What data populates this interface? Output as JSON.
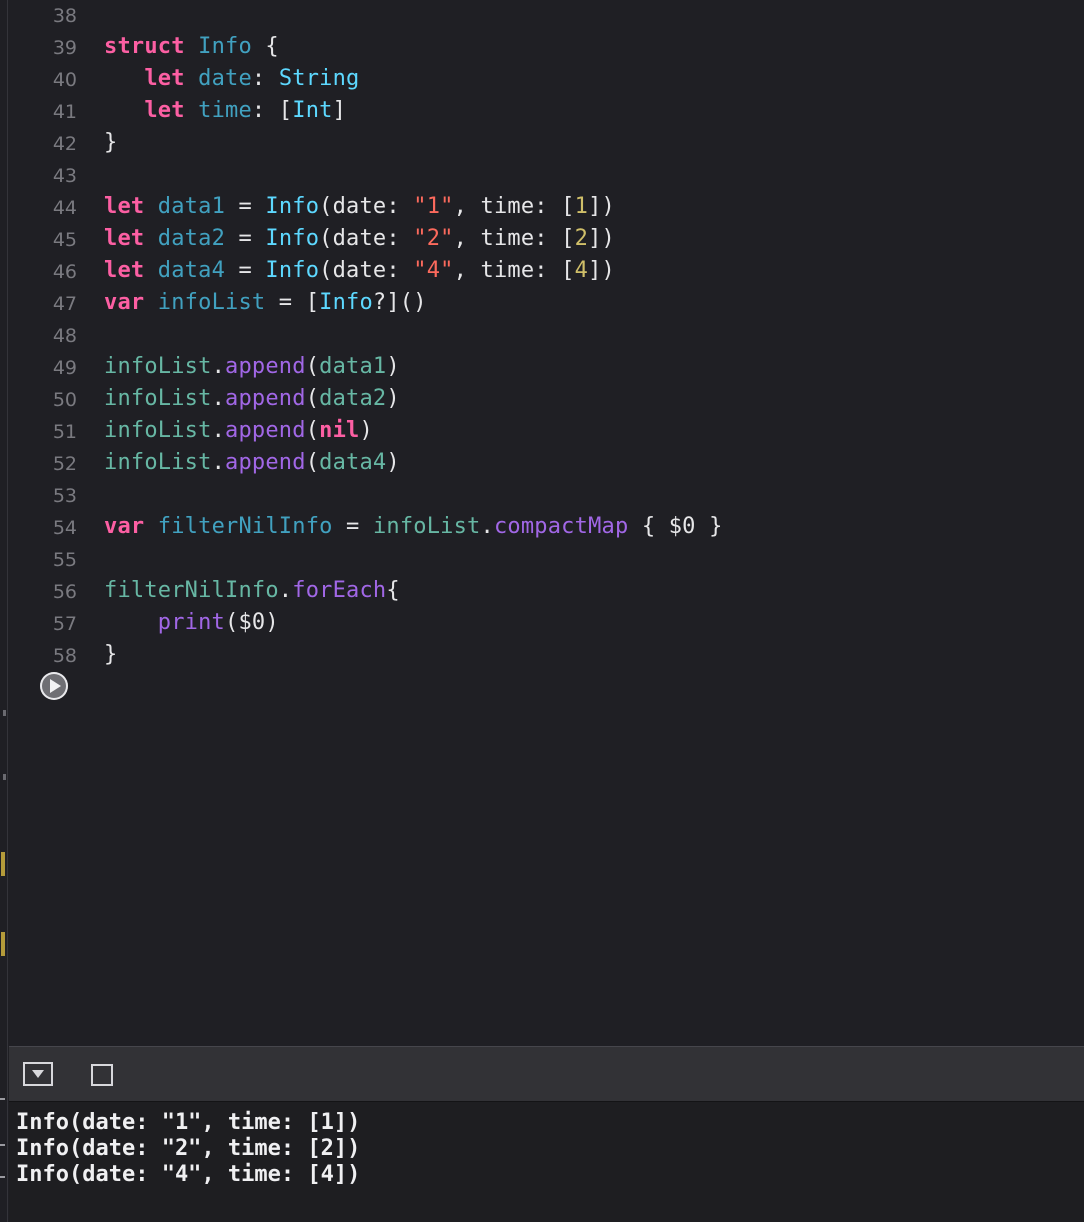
{
  "colors": {
    "background": "#1f1f24",
    "keyword": "#fc5fa3",
    "type": "#5dd8ff",
    "declaration": "#41a1c0",
    "string": "#fc6a5d",
    "number": "#d0bf69",
    "method": "#a167e6",
    "variable": "#67b7a4",
    "plain": "#e6e6e8",
    "line_number": "#7a7a80"
  },
  "editor": {
    "lines": [
      {
        "number": "38",
        "tokens": []
      },
      {
        "number": "39",
        "tokens": [
          {
            "text": "struct",
            "c": "kw"
          },
          {
            "text": " ",
            "c": "pl"
          },
          {
            "text": "Info",
            "c": "decl"
          },
          {
            "text": " {",
            "c": "pl"
          }
        ]
      },
      {
        "number": "40",
        "tokens": [
          {
            "text": "   ",
            "c": "pl"
          },
          {
            "text": "let",
            "c": "kw"
          },
          {
            "text": " ",
            "c": "pl"
          },
          {
            "text": "date",
            "c": "decl"
          },
          {
            "text": ": ",
            "c": "pl"
          },
          {
            "text": "String",
            "c": "tp"
          }
        ]
      },
      {
        "number": "41",
        "tokens": [
          {
            "text": "   ",
            "c": "pl"
          },
          {
            "text": "let",
            "c": "kw"
          },
          {
            "text": " ",
            "c": "pl"
          },
          {
            "text": "time",
            "c": "decl"
          },
          {
            "text": ": [",
            "c": "pl"
          },
          {
            "text": "Int",
            "c": "tp"
          },
          {
            "text": "]",
            "c": "pl"
          }
        ]
      },
      {
        "number": "42",
        "tokens": [
          {
            "text": "}",
            "c": "pl"
          }
        ]
      },
      {
        "number": "43",
        "tokens": []
      },
      {
        "number": "44",
        "tokens": [
          {
            "text": "let",
            "c": "kw"
          },
          {
            "text": " ",
            "c": "pl"
          },
          {
            "text": "data1",
            "c": "decl"
          },
          {
            "text": " = ",
            "c": "pl"
          },
          {
            "text": "Info",
            "c": "tp"
          },
          {
            "text": "(date: ",
            "c": "pl"
          },
          {
            "text": "\"1\"",
            "c": "str"
          },
          {
            "text": ", time: [",
            "c": "pl"
          },
          {
            "text": "1",
            "c": "num"
          },
          {
            "text": "])",
            "c": "pl"
          }
        ]
      },
      {
        "number": "45",
        "tokens": [
          {
            "text": "let",
            "c": "kw"
          },
          {
            "text": " ",
            "c": "pl"
          },
          {
            "text": "data2",
            "c": "decl"
          },
          {
            "text": " = ",
            "c": "pl"
          },
          {
            "text": "Info",
            "c": "tp"
          },
          {
            "text": "(date: ",
            "c": "pl"
          },
          {
            "text": "\"2\"",
            "c": "str"
          },
          {
            "text": ", time: [",
            "c": "pl"
          },
          {
            "text": "2",
            "c": "num"
          },
          {
            "text": "])",
            "c": "pl"
          }
        ]
      },
      {
        "number": "46",
        "tokens": [
          {
            "text": "let",
            "c": "kw"
          },
          {
            "text": " ",
            "c": "pl"
          },
          {
            "text": "data4",
            "c": "decl"
          },
          {
            "text": " = ",
            "c": "pl"
          },
          {
            "text": "Info",
            "c": "tp"
          },
          {
            "text": "(date: ",
            "c": "pl"
          },
          {
            "text": "\"4\"",
            "c": "str"
          },
          {
            "text": ", time: [",
            "c": "pl"
          },
          {
            "text": "4",
            "c": "num"
          },
          {
            "text": "])",
            "c": "pl"
          }
        ]
      },
      {
        "number": "47",
        "tokens": [
          {
            "text": "var",
            "c": "kw"
          },
          {
            "text": " ",
            "c": "pl"
          },
          {
            "text": "infoList",
            "c": "decl"
          },
          {
            "text": " = [",
            "c": "pl"
          },
          {
            "text": "Info",
            "c": "tp"
          },
          {
            "text": "?]()",
            "c": "pl"
          }
        ]
      },
      {
        "number": "48",
        "tokens": []
      },
      {
        "number": "49",
        "tokens": [
          {
            "text": "infoList",
            "c": "var"
          },
          {
            "text": ".",
            "c": "pl"
          },
          {
            "text": "append",
            "c": "mth"
          },
          {
            "text": "(",
            "c": "pl"
          },
          {
            "text": "data1",
            "c": "var"
          },
          {
            "text": ")",
            "c": "pl"
          }
        ]
      },
      {
        "number": "50",
        "tokens": [
          {
            "text": "infoList",
            "c": "var"
          },
          {
            "text": ".",
            "c": "pl"
          },
          {
            "text": "append",
            "c": "mth"
          },
          {
            "text": "(",
            "c": "pl"
          },
          {
            "text": "data2",
            "c": "var"
          },
          {
            "text": ")",
            "c": "pl"
          }
        ]
      },
      {
        "number": "51",
        "tokens": [
          {
            "text": "infoList",
            "c": "var"
          },
          {
            "text": ".",
            "c": "pl"
          },
          {
            "text": "append",
            "c": "mth"
          },
          {
            "text": "(",
            "c": "pl"
          },
          {
            "text": "nil",
            "c": "kw"
          },
          {
            "text": ")",
            "c": "pl"
          }
        ]
      },
      {
        "number": "52",
        "tokens": [
          {
            "text": "infoList",
            "c": "var"
          },
          {
            "text": ".",
            "c": "pl"
          },
          {
            "text": "append",
            "c": "mth"
          },
          {
            "text": "(",
            "c": "pl"
          },
          {
            "text": "data4",
            "c": "var"
          },
          {
            "text": ")",
            "c": "pl"
          }
        ]
      },
      {
        "number": "53",
        "tokens": []
      },
      {
        "number": "54",
        "tokens": [
          {
            "text": "var",
            "c": "kw"
          },
          {
            "text": " ",
            "c": "pl"
          },
          {
            "text": "filterNilInfo",
            "c": "decl"
          },
          {
            "text": " = ",
            "c": "pl"
          },
          {
            "text": "infoList",
            "c": "var"
          },
          {
            "text": ".",
            "c": "pl"
          },
          {
            "text": "compactMap",
            "c": "mth"
          },
          {
            "text": " { $0 }",
            "c": "pl"
          }
        ]
      },
      {
        "number": "55",
        "tokens": []
      },
      {
        "number": "56",
        "tokens": [
          {
            "text": "filterNilInfo",
            "c": "var"
          },
          {
            "text": ".",
            "c": "pl"
          },
          {
            "text": "forEach",
            "c": "mth"
          },
          {
            "text": "{",
            "c": "pl"
          }
        ]
      },
      {
        "number": "57",
        "tokens": [
          {
            "text": "    ",
            "c": "pl"
          },
          {
            "text": "print",
            "c": "mth"
          },
          {
            "text": "($0)",
            "c": "pl"
          }
        ]
      },
      {
        "number": "58",
        "tokens": [
          {
            "text": "}",
            "c": "pl"
          }
        ]
      }
    ]
  },
  "run_button": {
    "icon": "play-icon"
  },
  "debug_bar": {
    "toggle_icon": "hide-debug-area-icon",
    "square_icon": "stop-icon"
  },
  "console": {
    "lines": [
      "Info(date: \"1\", time: [1])",
      "Info(date: \"2\", time: [2])",
      "Info(date: \"4\", time: [4])"
    ]
  }
}
